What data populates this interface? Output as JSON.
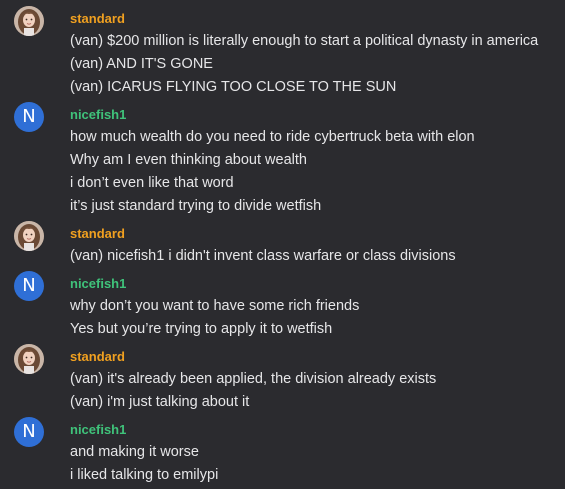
{
  "colors": {
    "background": "#2b2b2f",
    "username_standard": "#f0a020",
    "username_nicefish1": "#3fc27a",
    "avatar_letter_bg": "#2f6fd6",
    "text": "#e6e6e8"
  },
  "messages": [
    {
      "user": "standard",
      "avatar": "photo",
      "lines": [
        "(van) $200 million is literally enough to start a political dynasty in america",
        "(van) AND IT'S GONE",
        "(van) ICARUS FLYING TOO CLOSE TO THE SUN"
      ]
    },
    {
      "user": "nicefish1",
      "avatar_letter": "N",
      "lines": [
        "how much wealth do you need to ride cybertruck beta with elon",
        "Why am I even thinking about wealth",
        "i don’t even like that word",
        "it’s just standard trying to divide wetfish"
      ]
    },
    {
      "user": "standard",
      "avatar": "photo",
      "lines": [
        "(van) nicefish1 i didn't invent class warfare or class divisions"
      ]
    },
    {
      "user": "nicefish1",
      "avatar_letter": "N",
      "lines": [
        "why don’t you want to have some rich friends",
        "Yes but you’re trying to apply it to wetfish"
      ]
    },
    {
      "user": "standard",
      "avatar": "photo",
      "lines": [
        "(van) it's already been applied, the division already exists",
        "(van) i'm just talking about it"
      ]
    },
    {
      "user": "nicefish1",
      "avatar_letter": "N",
      "lines": [
        "and making it worse",
        "i liked talking to emilypi"
      ]
    }
  ]
}
